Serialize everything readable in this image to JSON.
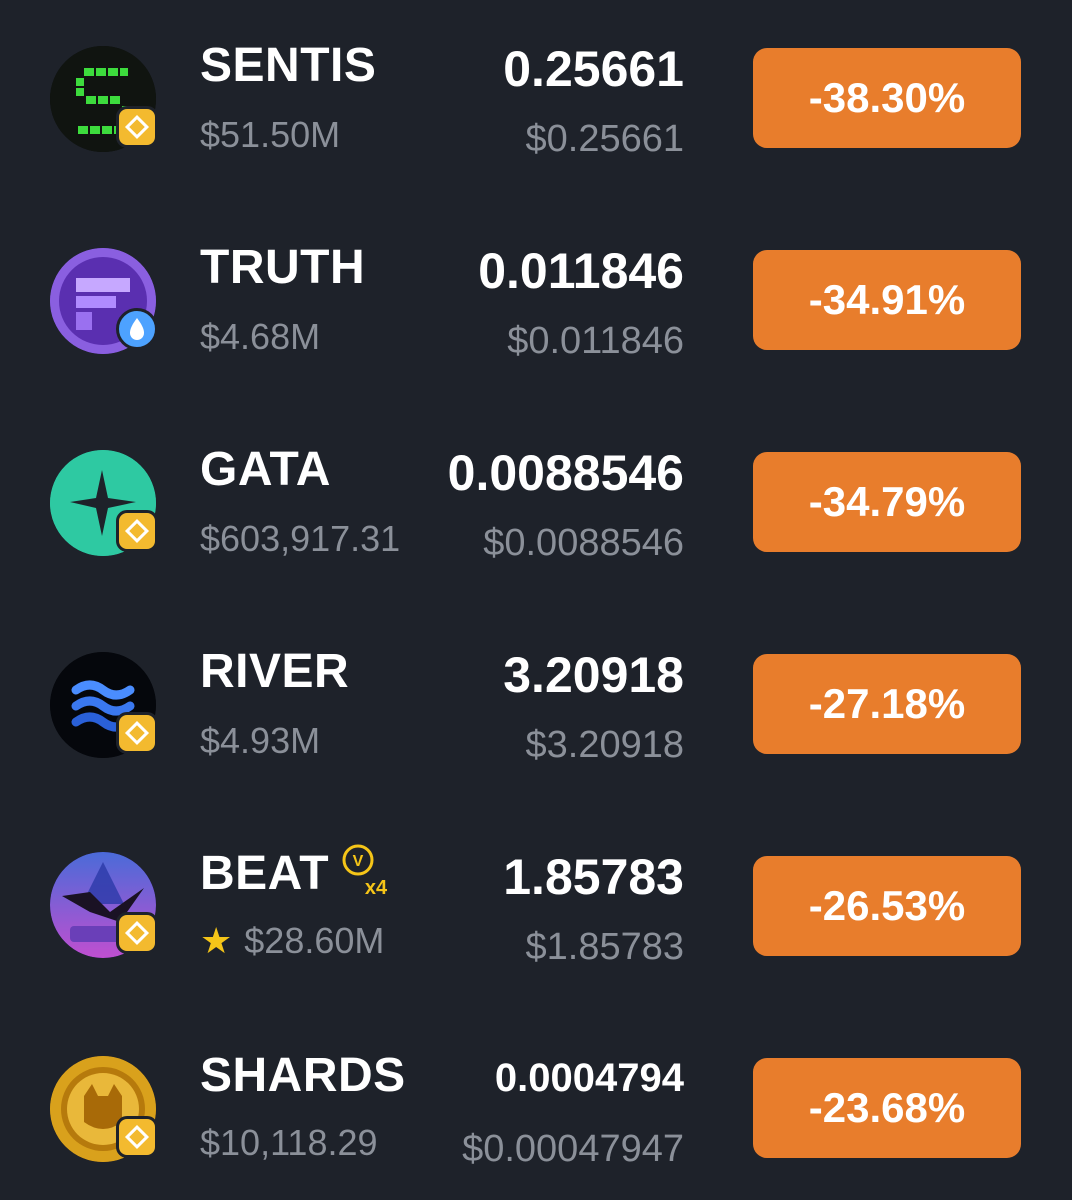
{
  "tokens": [
    {
      "name": "SENTIS",
      "market_cap": "$51.50M",
      "price": "0.25661",
      "price_usd": "$0.25661",
      "change": "-38.30%",
      "chain": "bnb-chain-icon"
    },
    {
      "name": "TRUTH",
      "market_cap": "$4.68M",
      "price": "0.011846",
      "price_usd": "$0.011846",
      "change": "-34.91%",
      "chain": "sui-chain-icon"
    },
    {
      "name": "GATA",
      "market_cap": "$603,917.31",
      "price": "0.0088546",
      "price_usd": "$0.0088546",
      "change": "-34.79%",
      "chain": "bnb-chain-icon"
    },
    {
      "name": "RIVER",
      "market_cap": "$4.93M",
      "price": "3.20918",
      "price_usd": "$3.20918",
      "change": "-27.18%",
      "chain": "bnb-chain-icon"
    },
    {
      "name": "BEAT",
      "market_cap": "$28.60M",
      "price": "1.85783",
      "price_usd": "$1.85783",
      "change": "-26.53%",
      "chain": "bnb-chain-icon",
      "boost_label": "x4"
    },
    {
      "name": "SHARDS",
      "market_cap": "$10,118.29",
      "price": "0.0004794",
      "price_usd": "$0.00047947",
      "change": "-23.68%",
      "chain": "bnb-chain-icon"
    }
  ],
  "colors": {
    "background": "#1e222a",
    "change_negative": "#e87d2c",
    "secondary_text": "#8b9099"
  }
}
